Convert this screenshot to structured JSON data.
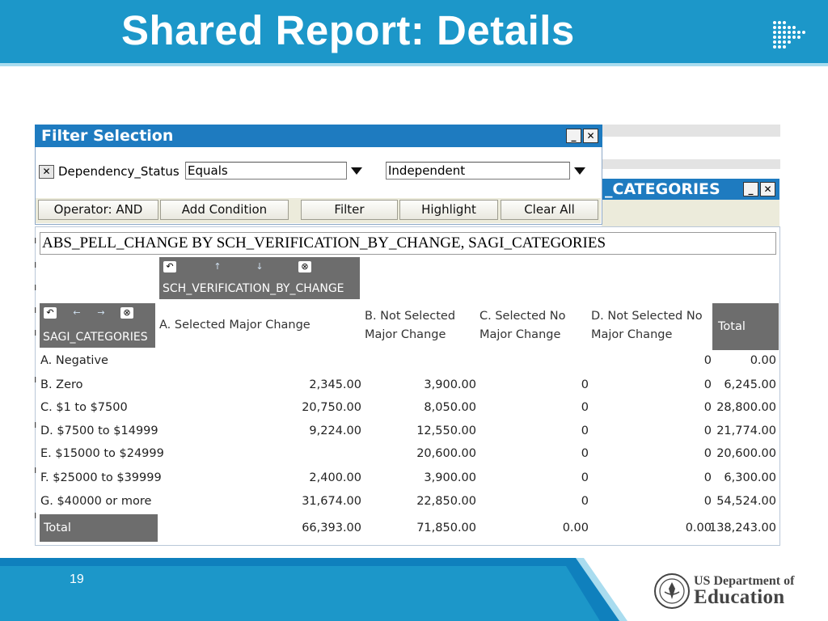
{
  "slide": {
    "title": "Shared Report: Details",
    "page_number": "19",
    "agency_line1": "US Department of",
    "agency_line2": "Education"
  },
  "filter_window": {
    "title": "Filter Selection",
    "minimize_label": "_",
    "close_label": "✕",
    "condition": {
      "remove_label": "✕",
      "field": "Dependency_Status",
      "operator": "Equals",
      "value": "Independent"
    },
    "buttons": {
      "operator": "Operator: AND",
      "add_condition": "Add Condition",
      "filter": "Filter",
      "highlight": "Highlight",
      "clear_all": "Clear All"
    }
  },
  "report_window": {
    "title_visible": "_CATEGORIES",
    "minimize_label": "_",
    "close_label": "✕",
    "heading": "ABS_PELL_CHANGE BY SCH_VERIFICATION_BY_CHANGE, SAGI_CATEGORIES",
    "column_dimension": "SCH_VERIFICATION_BY_CHANGE",
    "row_dimension": "SAGI_CATEGORIES",
    "columns": [
      {
        "line1": "A. Selected Major Change",
        "line2": ""
      },
      {
        "line1": "B. Not Selected",
        "line2": "Major Change"
      },
      {
        "line1": "C. Selected No",
        "line2": "Major Change"
      },
      {
        "line1": "D. Not Selected No",
        "line2": "Major Change"
      }
    ],
    "total_header": "Total",
    "rows": [
      {
        "label": "A. Negative",
        "a": "",
        "b": "",
        "c": "",
        "d": "0",
        "total": "0.00"
      },
      {
        "label": "B. Zero",
        "a": "2,345.00",
        "b": "3,900.00",
        "c": "0",
        "d": "0",
        "total": "6,245.00"
      },
      {
        "label": "C. $1 to $7500",
        "a": "20,750.00",
        "b": "8,050.00",
        "c": "0",
        "d": "0",
        "total": "28,800.00"
      },
      {
        "label": "D. $7500 to $14999",
        "a": "9,224.00",
        "b": "12,550.00",
        "c": "0",
        "d": "0",
        "total": "21,774.00"
      },
      {
        "label": "E. $15000 to $24999",
        "a": "",
        "b": "20,600.00",
        "c": "0",
        "d": "0",
        "total": "20,600.00"
      },
      {
        "label": "F. $25000 to $39999",
        "a": "2,400.00",
        "b": "3,900.00",
        "c": "0",
        "d": "0",
        "total": "6,300.00"
      },
      {
        "label": "G. $40000 or more",
        "a": "31,674.00",
        "b": "22,850.00",
        "c": "0",
        "d": "0",
        "total": "54,524.00"
      }
    ],
    "total_row": {
      "label": "Total",
      "a": "66,393.00",
      "b": "71,850.00",
      "c": "0.00",
      "d": "0.00",
      "total": "138,243.00"
    }
  },
  "colors": {
    "header_blue": "#1c97c9",
    "titlebar_blue": "#1e7bc0",
    "dimension_gray": "#6d6d6d",
    "button_bar": "#ecebdb",
    "footer_navy": "#183e6e"
  }
}
